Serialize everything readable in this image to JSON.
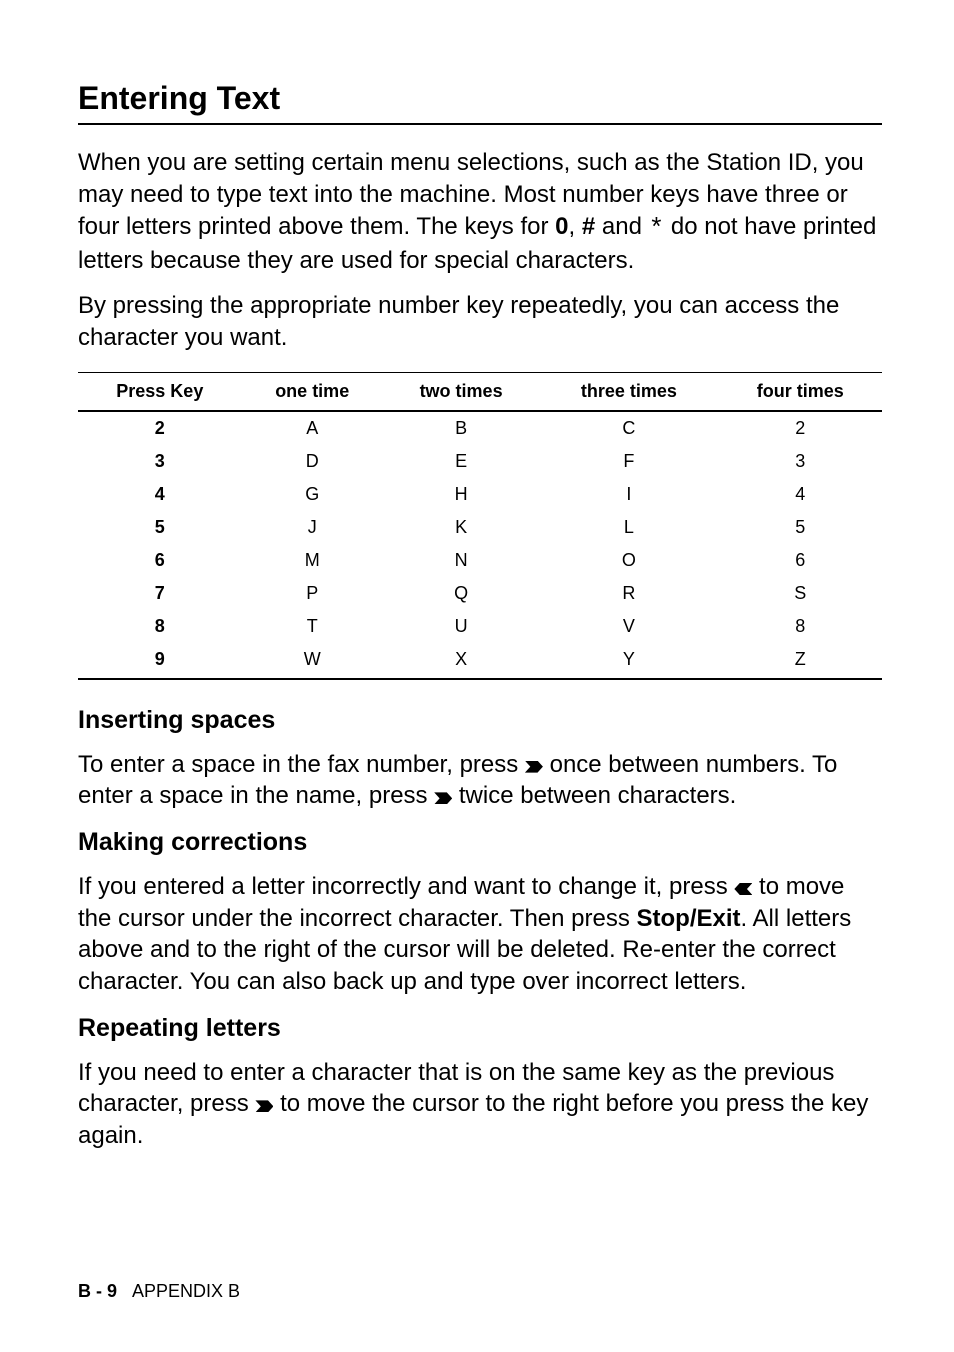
{
  "title": "Entering Text",
  "intro1_parts": [
    "When you are setting certain menu selections, such as the Station ID, you may need to type text into the machine. Most number keys have three or four letters printed above them. The keys for ",
    "0",
    ", ",
    "#",
    " and ",
    " do not have printed letters because they are used for special characters."
  ],
  "star_glyph": "*",
  "intro2": "By pressing the appropriate number key repeatedly, you can access the character you want.",
  "table": {
    "headers": [
      "Press Key",
      "one time",
      "two times",
      "three times",
      "four times"
    ],
    "rows": [
      [
        "2",
        "A",
        "B",
        "C",
        "2"
      ],
      [
        "3",
        "D",
        "E",
        "F",
        "3"
      ],
      [
        "4",
        "G",
        "H",
        "I",
        "4"
      ],
      [
        "5",
        "J",
        "K",
        "L",
        "5"
      ],
      [
        "6",
        "M",
        "N",
        "O",
        "6"
      ],
      [
        "7",
        "P",
        "Q",
        "R",
        "S"
      ],
      [
        "8",
        "T",
        "U",
        "V",
        "8"
      ],
      [
        "9",
        "W",
        "X",
        "Y",
        "Z"
      ]
    ]
  },
  "sections": {
    "spaces": {
      "heading": "Inserting spaces",
      "text_parts": [
        "To enter a space in the fax number, press ",
        " once between numbers. To enter a space in the name, press ",
        " twice between characters."
      ]
    },
    "corrections": {
      "heading": "Making corrections",
      "text_parts": [
        "If you entered a letter incorrectly and want to change it, press ",
        " to move the cursor under the incorrect character. Then press ",
        "Stop/Exit",
        ". All letters above and to the right of the cursor will be deleted. Re-enter the correct character. You can also back up and type over incorrect letters."
      ]
    },
    "repeating": {
      "heading": "Repeating letters",
      "text_parts": [
        "If you need to enter a character that is on the same key as the previous character, press ",
        " to move the cursor to the right before you press the key again."
      ]
    }
  },
  "footer": {
    "page": "B - 9",
    "label": "APPENDIX B"
  }
}
